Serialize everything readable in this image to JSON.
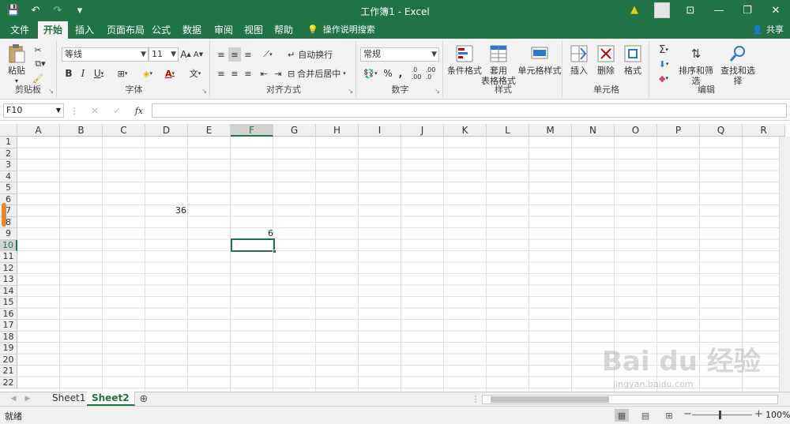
{
  "titlebar": {
    "title": "工作簿1 - Excel",
    "qat": {
      "save": "💾",
      "undo": "↶",
      "redo": "↷",
      "customize": "▾"
    },
    "controls": {
      "ribbon_display": "⊡",
      "minimize": "—",
      "restore": "❐",
      "close": "✕"
    }
  },
  "tabs": [
    {
      "label": "文件"
    },
    {
      "label": "开始"
    },
    {
      "label": "插入"
    },
    {
      "label": "页面布局"
    },
    {
      "label": "公式"
    },
    {
      "label": "数据"
    },
    {
      "label": "审阅"
    },
    {
      "label": "视图"
    },
    {
      "label": "帮助"
    }
  ],
  "tellme": "操作说明搜索",
  "share": "共享",
  "ribbon": {
    "clipboard": {
      "label": "剪贴板",
      "paste": "粘贴"
    },
    "font": {
      "label": "字体",
      "name": "等线",
      "size": "11",
      "bold": "B",
      "italic": "I",
      "underline": "U",
      "grow": "A",
      "shrink": "A"
    },
    "alignment": {
      "label": "对齐方式",
      "wrap": "自动换行",
      "merge": "合并后居中"
    },
    "number": {
      "label": "数字",
      "format": "常规",
      "percent": "%",
      "comma": ","
    },
    "styles": {
      "label": "样式",
      "conditional": "条件格式",
      "table_a": "套用",
      "table_b": "表格格式",
      "cell_styles": "单元格样式"
    },
    "cells": {
      "label": "单元格",
      "insert": "插入",
      "delete": "删除",
      "format": "格式"
    },
    "editing": {
      "label": "编辑",
      "sort": "排序和筛选",
      "find": "查找和选择",
      "sum": "Σ"
    }
  },
  "formula_bar": {
    "name_box": "F10",
    "fx": "fx",
    "cancel": "✕",
    "enter": "✓",
    "value": ""
  },
  "columns": [
    "A",
    "B",
    "C",
    "D",
    "E",
    "F",
    "G",
    "H",
    "I",
    "J",
    "K",
    "L",
    "M",
    "N",
    "O",
    "P",
    "Q",
    "R"
  ],
  "rows": [
    "1",
    "2",
    "3",
    "4",
    "5",
    "6",
    "7",
    "8",
    "9",
    "10",
    "11",
    "12",
    "13",
    "14",
    "15",
    "16",
    "17",
    "18",
    "19",
    "20",
    "21",
    "22"
  ],
  "cells": {
    "D7": "36",
    "F9": "6"
  },
  "sheets": [
    {
      "label": "Sheet1"
    },
    {
      "label": "Sheet2"
    }
  ],
  "add_sheet": "⊕",
  "status": {
    "ready": "就绪",
    "zoom": "100%",
    "zoom_minus": "−",
    "zoom_plus": "+"
  },
  "watermark": {
    "text": "Bai du 经验",
    "url": "jingyan.baidu.com"
  }
}
